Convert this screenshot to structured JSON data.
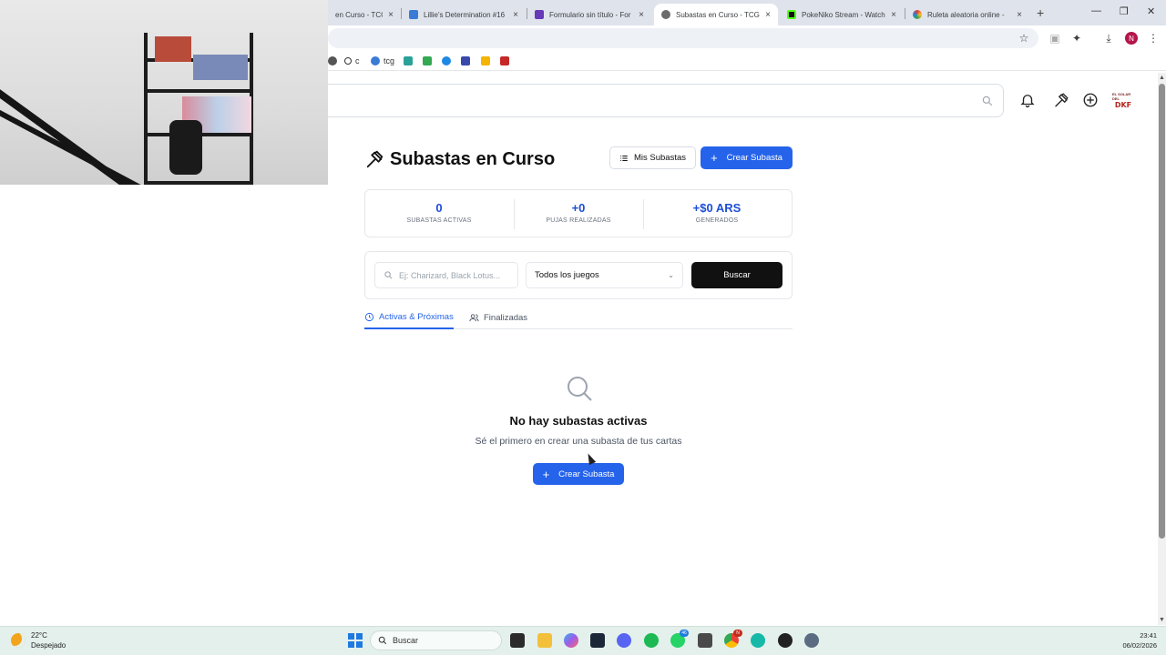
{
  "browser": {
    "tabs": [
      {
        "label": "en Curso - TCGp",
        "active": false,
        "favicon_color": "#888888"
      },
      {
        "label": "Lillie's Determination #16",
        "active": false,
        "favicon_color": "#3a7bd5"
      },
      {
        "label": "Formulario sin título - For",
        "active": false,
        "favicon_color": "#673ab7"
      },
      {
        "label": "Subastas en Curso - TCGp",
        "active": true,
        "favicon_color": "#555555"
      },
      {
        "label": "PokeNiko Stream - Watch",
        "active": false,
        "favicon_color": "#53fc18"
      },
      {
        "label": "Ruleta aleatoria online - ",
        "active": false,
        "favicon_color": "#e53935"
      }
    ],
    "tab_close_glyph": "×",
    "new_tab_glyph": "+",
    "window_controls": [
      "—",
      "❐",
      "✕"
    ],
    "profile_initial": "N",
    "bookmarks": [
      {
        "label": "",
        "color": "#555555"
      },
      {
        "label": "c",
        "color": "#333333"
      },
      {
        "label": "tcg",
        "color": "#3a7bd5"
      },
      {
        "label": "",
        "color": "#2aa198"
      },
      {
        "label": "",
        "color": "#1e88e5"
      },
      {
        "label": "",
        "color": "#34a853"
      },
      {
        "label": "",
        "color": "#3949ab"
      },
      {
        "label": "",
        "color": "#f4b400"
      },
      {
        "label": "",
        "color": "#c62828"
      }
    ]
  },
  "site": {
    "logo_top": "EL SOLAR DEL",
    "logo_bottom": "DKF"
  },
  "page": {
    "title": "Subastas en Curso",
    "my_auctions_label": "Mis Subastas",
    "create_auction_label": "Crear Subasta",
    "stats": [
      {
        "value": "0",
        "label": "SUBASTAS ACTIVAS"
      },
      {
        "value": "+0",
        "label": "PUJAS REALIZADAS"
      },
      {
        "value": "+$0 ARS",
        "label": "GENERADOS"
      }
    ],
    "search": {
      "placeholder": "Ej: Charizard, Black Lotus...",
      "value": ""
    },
    "game_filter": {
      "selected": "Todos los juegos"
    },
    "search_button": "Buscar",
    "tabs": [
      {
        "label": "Activas & Próximas",
        "active": true
      },
      {
        "label": "Finalizadas",
        "active": false
      }
    ],
    "empty": {
      "title": "No hay subastas activas",
      "subtitle": "Sé el primero en crear una subasta de tus cartas",
      "button": "Crear Subasta"
    }
  },
  "taskbar": {
    "weather_temp": "22°C",
    "weather_desc": "Despejado",
    "search_label": "Buscar",
    "time": "23:41",
    "date": "06/02/2026",
    "badges": {
      "whatsapp": "46",
      "chrome": "N"
    }
  },
  "colors": {
    "accent": "#2563eb",
    "stat_value": "#1d4ed8",
    "search_button": "#111111"
  }
}
